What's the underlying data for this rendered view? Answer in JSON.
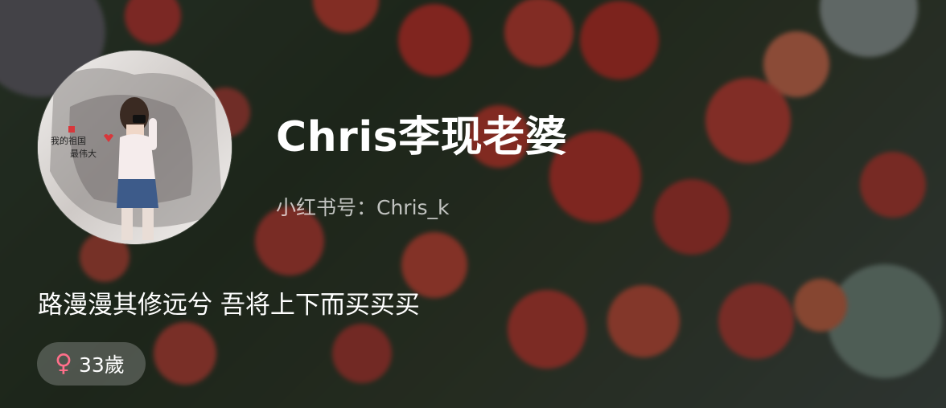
{
  "profile": {
    "nickname": "Chris李现老婆",
    "user_id": "小红书号：Chris_k",
    "bio": "路漫漫其修远兮 吾将上下而买买买",
    "gender_icon": "female-icon",
    "gender_symbol": "♀",
    "age": "33歲",
    "avatar_text_line1": "我的祖国",
    "avatar_text_line2": "最伟大"
  },
  "colors": {
    "gender_accent": "#ff6f8a",
    "text_primary": "#ffffff"
  }
}
